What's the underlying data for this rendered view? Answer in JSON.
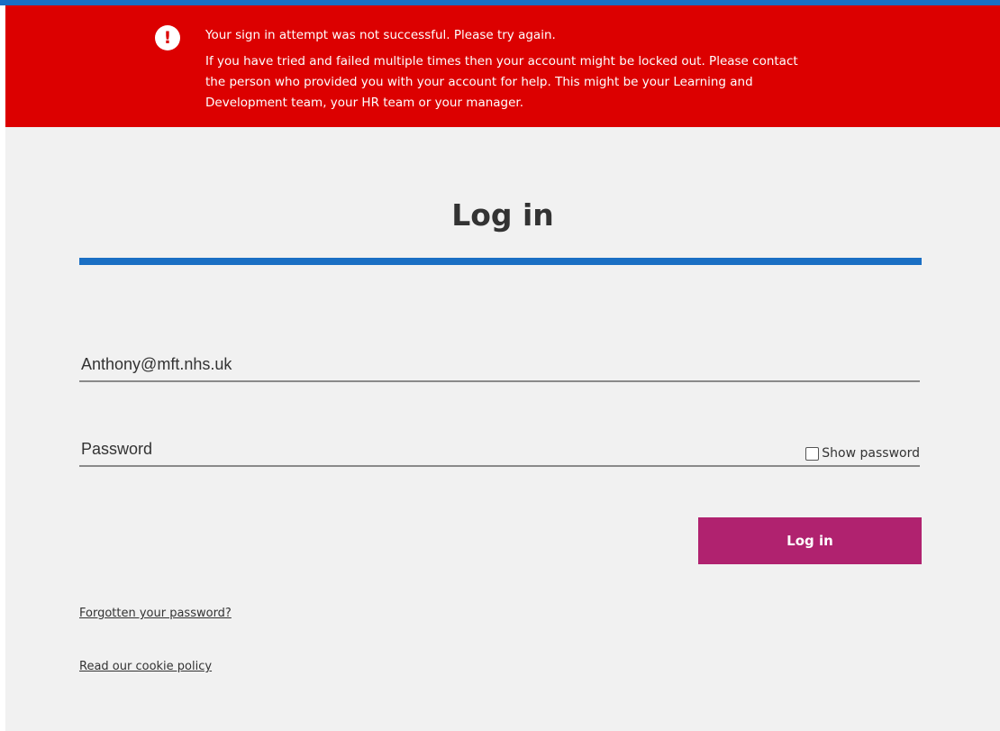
{
  "error_banner": {
    "icon": "exclamation-icon",
    "icon_glyph": "!",
    "title": "Your sign in attempt was not successful. Please try again.",
    "line1": "If you have tried and failed multiple times then your account might be locked out. Please contact",
    "line2": "the person who provided you with your account for help. This might be your Learning and",
    "line3": "Development team, your HR team or your manager."
  },
  "login": {
    "title": "Log in",
    "email_value": "Anthony@mft.nhs.uk",
    "password_placeholder": "Password",
    "show_password_label": "Show password",
    "show_password_checked": false,
    "submit_label": "Log in"
  },
  "links": {
    "forgot_password": "Forgotten your password?",
    "cookie_policy": "Read our cookie policy"
  },
  "colors": {
    "accent_blue": "#1a6fc4",
    "error_red": "#dc0000",
    "button_magenta": "#b0226f",
    "panel_background": "#f1f1f1"
  }
}
